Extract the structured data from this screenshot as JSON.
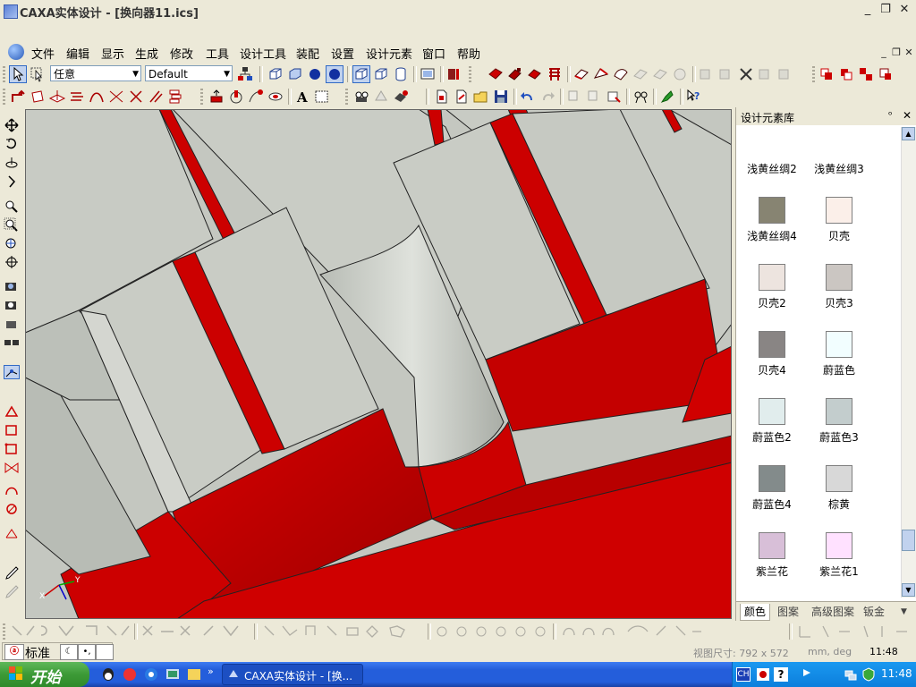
{
  "window": {
    "title": "CAXA实体设计 - [换向器11.ics]",
    "controls": [
      "_",
      "❐",
      "✕"
    ],
    "doc_controls": [
      "_",
      "❐",
      "✕"
    ]
  },
  "menu": {
    "items": [
      "文件",
      "编辑",
      "显示",
      "生成",
      "修改",
      "工具",
      "设计工具",
      "装配",
      "设置",
      "设计元素",
      "窗口",
      "帮助"
    ]
  },
  "toolbar1": {
    "select_filter": "任意",
    "style_combo": "Default"
  },
  "panel": {
    "title": "设计元素库",
    "pin": "ᵒ",
    "close": "✕",
    "swatches": [
      {
        "label": "浅黄丝绸2",
        "color": ""
      },
      {
        "label": "浅黄丝绸3",
        "color": ""
      },
      {
        "label": "浅黄丝绸4",
        "color": "#878472"
      },
      {
        "label": "贝壳",
        "color": "#fbefe9"
      },
      {
        "label": "贝壳2",
        "color": "#ede4df"
      },
      {
        "label": "贝壳3",
        "color": "#cbc6c2"
      },
      {
        "label": "贝壳4",
        "color": "#898584"
      },
      {
        "label": "蔚蓝色",
        "color": "#f2feff"
      },
      {
        "label": "蔚蓝色2",
        "color": "#e1eded"
      },
      {
        "label": "蔚蓝色3",
        "color": "#c3cdcd"
      },
      {
        "label": "蔚蓝色4",
        "color": "#838b8b"
      },
      {
        "label": "棕黄",
        "color": "#d8d8d8"
      },
      {
        "label": "紫兰花",
        "color": "#d8bfd8"
      },
      {
        "label": "紫兰花1",
        "color": "#ffe1ff"
      },
      {
        "label": "",
        "color": "#eed2ee"
      },
      {
        "label": "",
        "color": "#cdb5cd"
      }
    ],
    "tabs": [
      "颜色",
      "图案",
      "高级图案",
      "钣金"
    ]
  },
  "statusbar": {
    "ime": "标准",
    "view_size": "视图尺寸: 792 x 572",
    "units": "mm, deg",
    "time": "11:48"
  },
  "viewport": {
    "triad_x": "X",
    "triad_y": "Y"
  },
  "taskbar": {
    "start": "开始",
    "task": "CAXA实体设计 - [换...",
    "lang": "CH",
    "time": "11:48"
  },
  "colors": {
    "accent_red": "#d40000",
    "body_gray": "#c6c9c2",
    "taskbar_blue": "#245edb"
  }
}
